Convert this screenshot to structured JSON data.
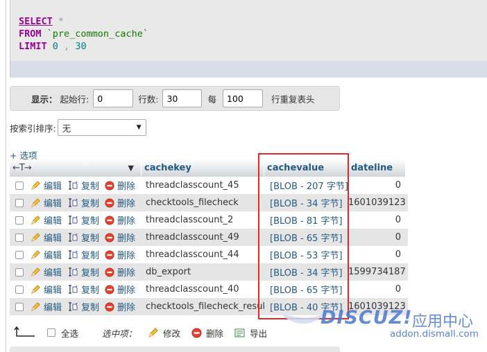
{
  "sql": {
    "line1_kw": "SELECT",
    "line1_rest": "*",
    "line2_kw": "FROM",
    "line2_rest": "`pre_common_cache`",
    "line3_kw": "LIMIT",
    "line3_a": "0",
    "line3_sep": ",",
    "line3_b": "30"
  },
  "display": {
    "label": "显示：",
    "start_label": "起始行:",
    "start_value": "0",
    "rows_label": "行数:",
    "rows_value": "30",
    "every_label": "每",
    "every_value": "100",
    "repeat_label": "行重复表头"
  },
  "sort": {
    "label": "按索引排序:",
    "selected": "无"
  },
  "options_link": "+ 选项",
  "table": {
    "headers": {
      "controls": "←T→",
      "cachekey": "cachekey",
      "cachevalue": "cachevalue",
      "dateline": "dateline"
    },
    "action_labels": {
      "edit": "编辑",
      "copy": "复制",
      "delete": "删除"
    },
    "rows": [
      {
        "cachekey": "threadclasscount_45",
        "cachevalue": "[BLOB - 207 字节]",
        "dateline": "0"
      },
      {
        "cachekey": "checktools_filecheck",
        "cachevalue": "[BLOB - 34 字节]",
        "dateline": "1601039123"
      },
      {
        "cachekey": "threadclasscount_2",
        "cachevalue": "[BLOB - 81 字节]",
        "dateline": "0"
      },
      {
        "cachekey": "threadclasscount_49",
        "cachevalue": "[BLOB - 65 字节]",
        "dateline": "0"
      },
      {
        "cachekey": "threadclasscount_44",
        "cachevalue": "[BLOB - 53 字节]",
        "dateline": "0"
      },
      {
        "cachekey": "db_export",
        "cachevalue": "[BLOB - 34 字节]",
        "dateline": "1599734187"
      },
      {
        "cachekey": "threadclasscount_40",
        "cachevalue": "[BLOB - 65 字节]",
        "dateline": "0"
      },
      {
        "cachekey": "checktools_filecheck_result",
        "cachevalue": "[BLOB - 40 字节]",
        "dateline": "1601039123"
      }
    ]
  },
  "bottom": {
    "select_all": "全选",
    "with_selected": "选中项：",
    "modify": "修改",
    "delete": "删除",
    "export": "导出"
  },
  "watermark": {
    "logo": "DISCUZ!",
    "cn": "应用中心",
    "url": "addon.dismall.com"
  },
  "colors": {
    "link": "#235a81",
    "highlight": "#e0272b",
    "sql_keyword": "#990099",
    "sql_identifier": "#117700"
  }
}
